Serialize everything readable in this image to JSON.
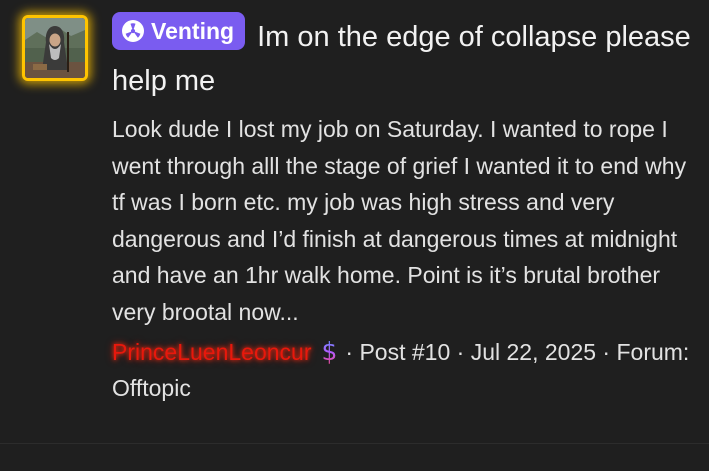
{
  "post": {
    "badge_label": "Venting",
    "badge_color": "#7a5cf0",
    "badge_icon": "radiation-icon",
    "title": "Im on the edge of collapse please help me",
    "body": "Look dude I lost my job on Saturday. I wanted to rope I went through alll the stage of grief I wanted it to end why tf was I born etc. my job was high stress and very dangerous and I’d finish at dangerous times at midnight and have an 1hr walk home. Point is it’s brutal brother very brootal now...",
    "author": "PrinceLuenLeoncur",
    "author_color": "#e8180c",
    "author_badge_icon": "dollar-icon",
    "post_number": "Post #10",
    "date": "Jul 22, 2025",
    "forum": "Forum: Offtopic",
    "separator": "·"
  }
}
